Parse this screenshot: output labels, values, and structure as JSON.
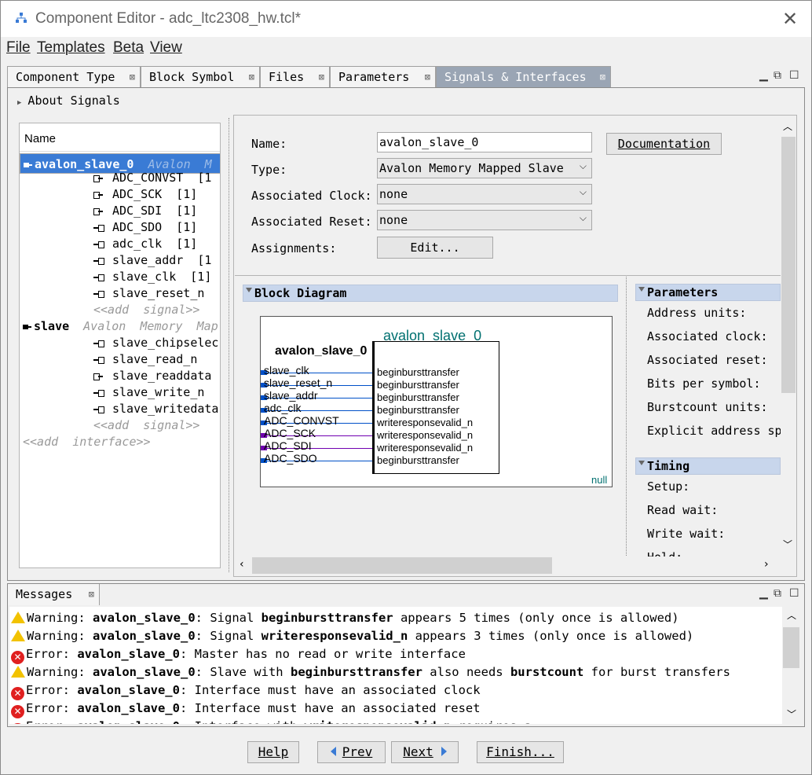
{
  "window": {
    "title": "Component Editor - adc_ltc2308_hw.tcl*",
    "close_glyph": "✕"
  },
  "menu": [
    "File",
    "Templates",
    "Beta",
    "View"
  ],
  "tabs": [
    {
      "label": "Component Type"
    },
    {
      "label": "Block Symbol"
    },
    {
      "label": "Files"
    },
    {
      "label": "Parameters"
    },
    {
      "label": "Signals & Interfaces"
    }
  ],
  "about": "About Signals",
  "tree": {
    "header": "Name",
    "rows": [
      {
        "name": "avalon_slave_0",
        "type": "Avalon",
        "extra": "M",
        "kind": "interface",
        "selected": true
      },
      {
        "name": "ADC_CONVST",
        "extra": "[1",
        "kind": "out"
      },
      {
        "name": "ADC_SCK",
        "extra": "[1]",
        "kind": "out"
      },
      {
        "name": "ADC_SDI",
        "extra": "[1]",
        "kind": "out"
      },
      {
        "name": "ADC_SDO",
        "extra": "[1]",
        "kind": "in"
      },
      {
        "name": "adc_clk",
        "extra": "[1]",
        "kind": "in"
      },
      {
        "name": "slave_addr",
        "extra": "[1",
        "kind": "in"
      },
      {
        "name": "slave_clk",
        "extra": "[1]",
        "kind": "in"
      },
      {
        "name": "slave_reset_n",
        "extra": "",
        "kind": "in"
      },
      {
        "name": "<<add  signal>>",
        "kind": "add"
      },
      {
        "name": "slave",
        "type": "Avalon  Memory  Map",
        "kind": "interface2"
      },
      {
        "name": "slave_chipselec",
        "kind": "in"
      },
      {
        "name": "slave_read_n",
        "kind": "in"
      },
      {
        "name": "slave_readdata",
        "kind": "out"
      },
      {
        "name": "slave_write_n",
        "kind": "in"
      },
      {
        "name": "slave_writedata",
        "kind": "in"
      },
      {
        "name": "<<add  signal>>",
        "kind": "add"
      },
      {
        "name": "<<add  interface>>",
        "kind": "addif"
      }
    ]
  },
  "form": {
    "name_label": "Name:",
    "name_value": "avalon_slave_0",
    "type_label": "Type:",
    "type_value": "Avalon Memory Mapped Slave",
    "clock_label": "Associated Clock:",
    "clock_value": "none",
    "reset_label": "Associated Reset:",
    "reset_value": "none",
    "assign_label": "Assignments:",
    "edit_button": "Edit...",
    "doc_button": "Documentation"
  },
  "block_diagram": {
    "header": "Block Diagram",
    "title": "avalon_slave_0",
    "left_label": "avalon_slave_0",
    "left_signals": [
      "slave_clk",
      "slave_reset_n",
      "slave_addr",
      "adc_clk",
      "ADC_CONVST",
      "ADC_SCK",
      "ADC_SDI",
      "ADC_SDO"
    ],
    "right_signals": [
      "beginbursttransfer",
      "beginbursttransfer",
      "beginbursttransfer",
      "beginbursttransfer",
      "writeresponsevalid_n",
      "writeresponsevalid_n",
      "writeresponsevalid_n",
      "beginbursttransfer"
    ],
    "null_label": "null",
    "colors": {
      "blue": "#0050c8",
      "purple": "#7000b0",
      "teal": "#007070"
    }
  },
  "params": {
    "header": "Parameters",
    "items": [
      "Address units:",
      "Associated clock:",
      "Associated reset:",
      "Bits per symbol:",
      "Burstcount units:",
      "Explicit address sp"
    ],
    "timing_header": "Timing",
    "timing_items": [
      "Setup:",
      "Read wait:",
      "Write wait:",
      "Hold:"
    ]
  },
  "messages": {
    "tab": "Messages",
    "items": [
      {
        "level": "warn",
        "prefix": "Warning: ",
        "iface": "avalon_slave_0",
        "parts": [
          ": Signal ",
          {
            "b": "beginbursttransfer"
          },
          " appears 5 times (only once is allowed)"
        ]
      },
      {
        "level": "warn",
        "prefix": "Warning: ",
        "iface": "avalon_slave_0",
        "parts": [
          ": Signal ",
          {
            "b": "writeresponsevalid_n"
          },
          " appears 3 times (only once is allowed)"
        ]
      },
      {
        "level": "err",
        "prefix": "Error: ",
        "iface": "avalon_slave_0",
        "parts": [
          ": Master has no read or write interface"
        ]
      },
      {
        "level": "warn",
        "prefix": "Warning: ",
        "iface": "avalon_slave_0",
        "parts": [
          ": Slave with ",
          {
            "b": "beginbursttransfer"
          },
          " also needs ",
          {
            "b": "burstcount"
          },
          " for burst transfers"
        ]
      },
      {
        "level": "err",
        "prefix": "Error: ",
        "iface": "avalon_slave_0",
        "parts": [
          ": Interface must have an associated clock"
        ]
      },
      {
        "level": "err",
        "prefix": "Error: ",
        "iface": "avalon_slave_0",
        "parts": [
          ": Interface must have an associated reset"
        ]
      },
      {
        "level": "err",
        "prefix": "Error: ",
        "iface": "avalon_slave_0",
        "parts": [
          ": Interface with ",
          {
            "b": "writeresponsevalid_n"
          },
          " requires a ..."
        ]
      }
    ]
  },
  "buttons": {
    "help": "Help",
    "prev": "Prev",
    "next": "Next",
    "finish": "Finish..."
  }
}
